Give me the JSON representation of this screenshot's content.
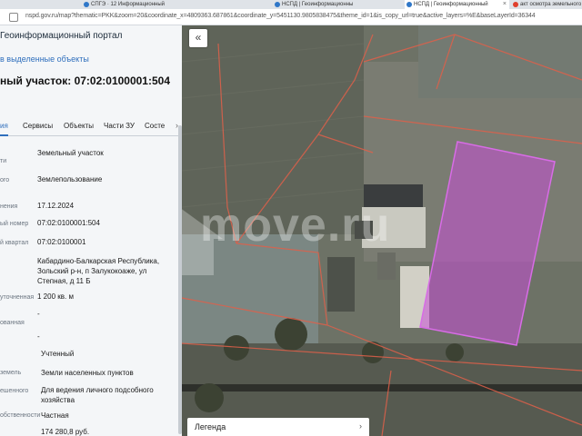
{
  "browser": {
    "tabs": [
      {
        "label": "СПГЭ · 12 Информационный"
      },
      {
        "label": "НСПД | Геоинформационны"
      },
      {
        "label": "НСПД | Геоинформационный"
      },
      {
        "label": "акт осмотра земельного"
      }
    ],
    "url": "nspd.gov.ru/map?thematic=PKK&zoom=20&coordinate_x=4809363.687861&coordinate_y=5451130.9805838475&theme_id=1&is_copy_url=true&active_layers=%E&baseLayerId=36344"
  },
  "panel": {
    "portal_title": "Геоинформационный портал",
    "selection_link": "в выделенные объекты",
    "plot_title": "ный участок: 07:02:0100001:504",
    "tabs": [
      {
        "label": "ия"
      },
      {
        "label": "Сервисы"
      },
      {
        "label": "Объекты"
      },
      {
        "label": "Части ЗУ"
      },
      {
        "label": "Состе"
      }
    ],
    "tab_nav": "›",
    "rows": [
      {
        "label": "ти",
        "value": "Земельный участок"
      },
      {
        "label": "ого",
        "value": "Землепользование"
      },
      {
        "label": "нения",
        "value": "17.12.2024"
      },
      {
        "label": "ый номер",
        "value": "07:02:0100001:504"
      },
      {
        "label": "й квартал",
        "value": "07:02:0100001"
      },
      {
        "label": "",
        "value": "Кабардино-Балкарская Республика, Зольский р-н, п Залукокоаже, ул Степная, д 11 Б"
      },
      {
        "label": "уточненная",
        "value": "1 200 кв. м"
      },
      {
        "label": "ованная",
        "value": "-"
      },
      {
        "label": "",
        "value": "-"
      },
      {
        "label": "",
        "value": "Учтенный"
      },
      {
        "label": "земель",
        "value": "Земли населенных пунктов"
      },
      {
        "label": "ешенного",
        "value": "Для ведения личного подсобного хозяйства"
      },
      {
        "label": "обственности",
        "value": "Частная"
      },
      {
        "label": "",
        "value": "174 280,8 руб."
      }
    ]
  },
  "map": {
    "collapse_icon": "«",
    "legend_label": "Легенда",
    "legend_chevron": "›",
    "watermark": "move.ru",
    "highlight_color": "#c64fd6",
    "boundary_color": "#e0604a"
  }
}
